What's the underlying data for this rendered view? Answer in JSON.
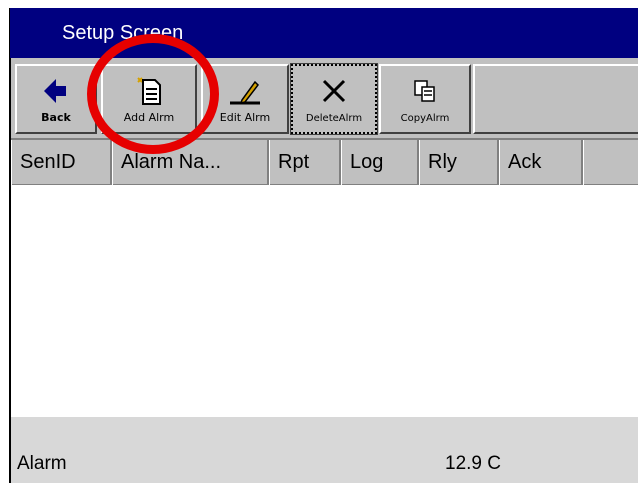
{
  "window": {
    "title": "Setup Screen"
  },
  "toolbar": {
    "buttons": [
      {
        "label": "Back",
        "icon": "back-arrow-icon"
      },
      {
        "label": "Add Alrm",
        "icon": "new-document-icon"
      },
      {
        "label": "Edit Alrm",
        "icon": "pencil-icon"
      },
      {
        "label": "DeleteAlrm",
        "icon": "delete-x-icon"
      },
      {
        "label": "CopyAlrm",
        "icon": "copy-icon"
      }
    ]
  },
  "table": {
    "columns": [
      "SenID",
      "Alarm Na...",
      "Rpt",
      "Log",
      "Rly",
      "Ack",
      ""
    ]
  },
  "status": {
    "left": "Alarm",
    "right": "12.9 C"
  },
  "colors": {
    "title_bar": "#000080",
    "annotation": "#e60000",
    "toolbar": "#c0c0c0"
  }
}
